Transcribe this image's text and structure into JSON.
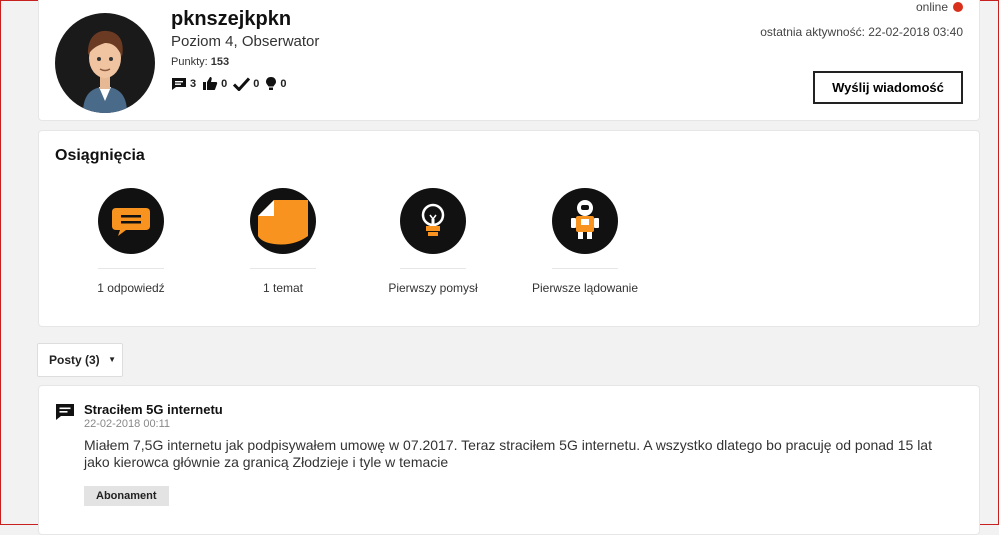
{
  "profile": {
    "username": "pknszejkpkn",
    "level": "Poziom 4, Obserwator",
    "points_label": "Punkty:",
    "points_value": "153",
    "stats": {
      "replies": "3",
      "likes": "0",
      "solutions": "0",
      "ideas": "0"
    },
    "online_label": "online",
    "last_activity": "ostatnia aktywność: 22-02-2018 03:40",
    "message_button": "Wyślij wiadomość"
  },
  "achievements": {
    "title": "Osiągnięcia",
    "items": [
      {
        "label": "1 odpowiedź",
        "icon": "speech-bubble-icon"
      },
      {
        "label": "1 temat",
        "icon": "sticky-note-icon"
      },
      {
        "label": "Pierwszy pomysł",
        "icon": "lightbulb-icon"
      },
      {
        "label": "Pierwsze lądowanie",
        "icon": "astronaut-icon"
      }
    ]
  },
  "posts_filter": {
    "label": "Posty (3)"
  },
  "post": {
    "title": "Straciłem 5G internetu",
    "date": "22-02-2018 00:11",
    "body": "Miałem 7,5G internetu jak podpisywałem umowę w 07.2017. Teraz straciłem 5G internetu. A wszystko dlatego bo pracuję od ponad 15 lat jako kierowca głównie za granicą Złodzieje i tyle w temacie",
    "tag": "Abonament"
  },
  "colors": {
    "accent_orange": "#f7931e",
    "status_red": "#d9301c",
    "badge_dark": "#111111"
  }
}
